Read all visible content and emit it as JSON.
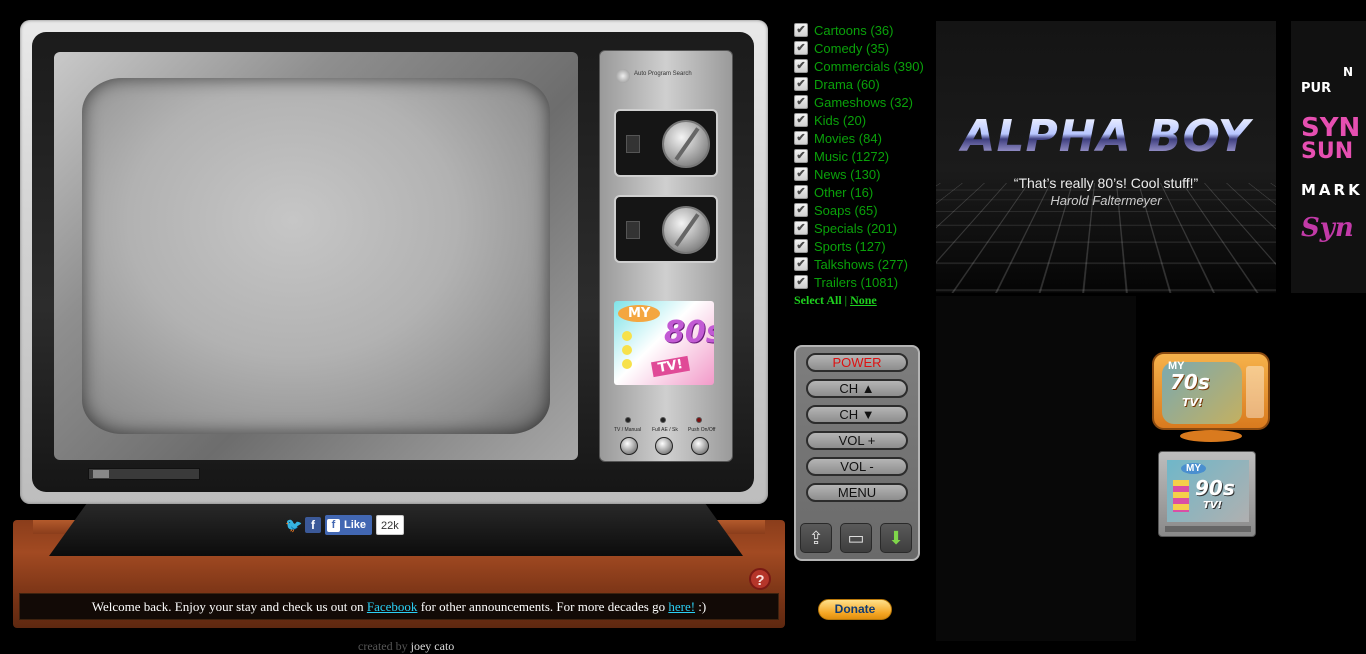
{
  "colors": {
    "category_text": "#0aa10a",
    "select_links": "#1ed01e",
    "power_label": "#dd1111",
    "message_link": "#2ad0f5",
    "cabinet_wood": "#8a3d1b"
  },
  "tv": {
    "panel_small_label": "Auto Program Search",
    "logo": {
      "my": "MY",
      "decade": "80s",
      "tv": "TV!"
    },
    "panel_buttons": [
      {
        "label": "TV / Manual"
      },
      {
        "label": "Full AE / Sk"
      },
      {
        "label": "Push On/Off"
      }
    ]
  },
  "social": {
    "twitter_icon": "twitter-icon",
    "facebook_icon": "facebook-icon",
    "like_label": "Like",
    "like_count": "22k"
  },
  "help": {
    "icon": "?"
  },
  "message": {
    "part1": "Welcome back. Enjoy your stay and check us out on ",
    "link1": "Facebook",
    "part2": " for other announcements. For more decades go ",
    "link2": "here!",
    "part3": " :)"
  },
  "credit": {
    "label": "created by",
    "name": "joey cato"
  },
  "categories": [
    {
      "label": "Cartoons (36)",
      "checked": true
    },
    {
      "label": "Comedy (35)",
      "checked": true
    },
    {
      "label": "Commercials (390)",
      "checked": true
    },
    {
      "label": "Drama (60)",
      "checked": true
    },
    {
      "label": "Gameshows (32)",
      "checked": true
    },
    {
      "label": "Kids (20)",
      "checked": true
    },
    {
      "label": "Movies (84)",
      "checked": true
    },
    {
      "label": "Music (1272)",
      "checked": true
    },
    {
      "label": "News (130)",
      "checked": true
    },
    {
      "label": "Other (16)",
      "checked": true
    },
    {
      "label": "Soaps (65)",
      "checked": true
    },
    {
      "label": "Specials (201)",
      "checked": true
    },
    {
      "label": "Sports (127)",
      "checked": true
    },
    {
      "label": "Talkshows (277)",
      "checked": true
    },
    {
      "label": "Trailers (1081)",
      "checked": true
    }
  ],
  "selection": {
    "all": "Select All",
    "separator": "|",
    "none": "None"
  },
  "remote": {
    "power": "POWER",
    "ch_up": "CH ▲",
    "ch_down": "CH ▼",
    "vol_up": "VOL +",
    "vol_down": "VOL -",
    "menu": "MENU",
    "share_icon": "share-icon",
    "chat_icon": "chat-icon",
    "download_icon": "download-icon"
  },
  "donate": {
    "label": "Donate"
  },
  "banner": {
    "title": "ALPHA BOY",
    "quote": "“That’s really 80’s! Cool stuff!”",
    "author": "Harold Faltermeyer"
  },
  "banner2": {
    "line1": "N",
    "line1b": "PUR",
    "line2": "SYN",
    "line3": "SUN",
    "line4": "MARK",
    "line5": "Syn"
  },
  "decades": {
    "seventies": {
      "my": "MY",
      "label": "70s",
      "tv": "TV!"
    },
    "nineties": {
      "my": "MY",
      "label": "90s",
      "tv": "TV!"
    }
  }
}
